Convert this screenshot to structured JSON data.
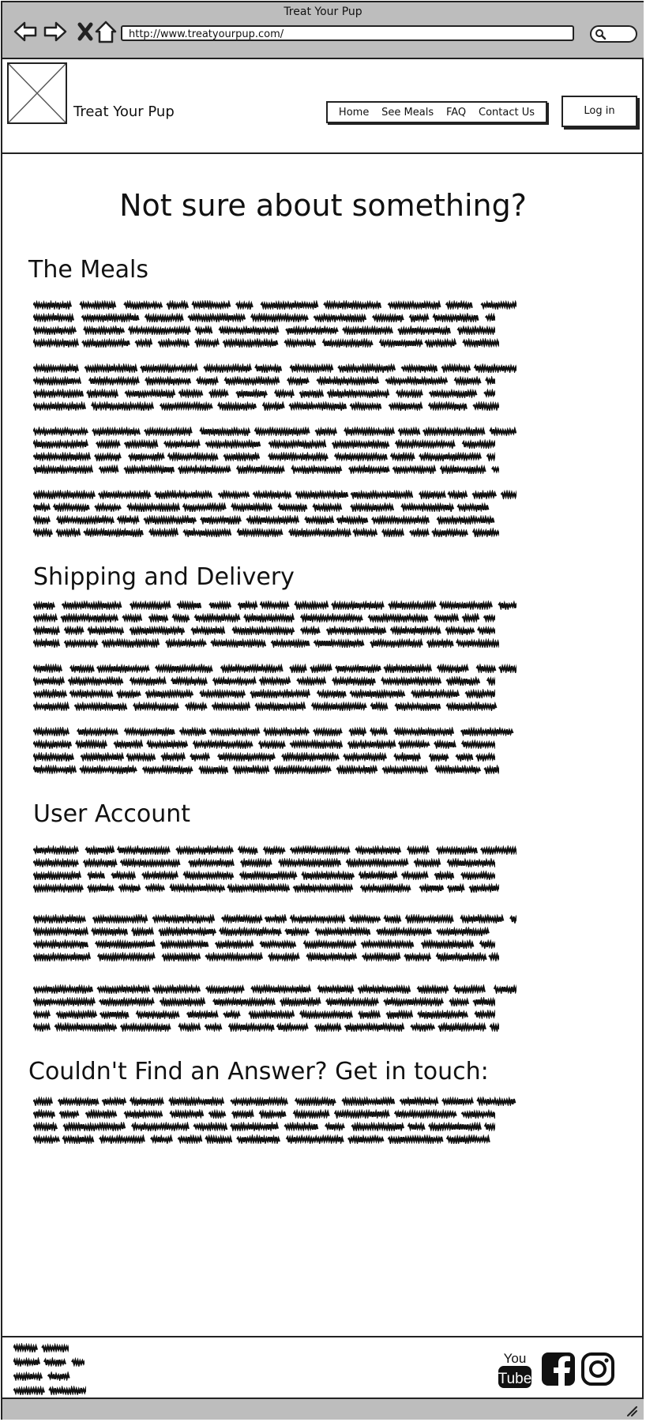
{
  "window": {
    "title": "Treat Your Pup",
    "url": "http://www.treatyourpup.com/"
  },
  "header": {
    "brand": "Treat Your Pup",
    "nav": [
      "Home",
      "See Meals",
      "FAQ",
      "Contact Us"
    ],
    "login_label": "Log in"
  },
  "main": {
    "title": "Not sure about something?",
    "sections": [
      {
        "heading": "The Meals",
        "paragraphs": 4
      },
      {
        "heading": "Shipping and Delivery",
        "paragraphs": 3
      },
      {
        "heading": "User Account",
        "paragraphs": 3
      },
      {
        "heading": "Couldn't Find an Answer? Get in touch:",
        "paragraphs": 1
      }
    ]
  },
  "footer": {
    "social_icons": [
      "youtube-icon",
      "facebook-icon",
      "instagram-icon"
    ],
    "youtube_top": "You",
    "youtube_bottom": "Tube"
  }
}
